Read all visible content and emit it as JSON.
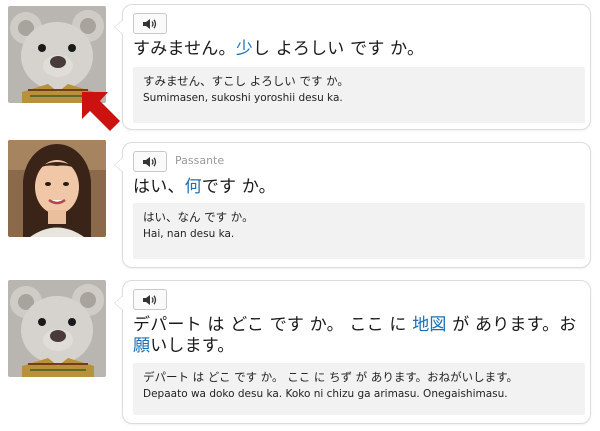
{
  "lines": [
    {
      "speaker": "",
      "main": [
        {
          "t": "すみません。",
          "hl": false
        },
        {
          "t": "少",
          "hl": true
        },
        {
          "t": "し よろしい です か。",
          "hl": false
        }
      ],
      "kana": "すみません、すこし よろしい です か。",
      "romaji": "Sumimasen, sukoshi yoroshii desu ka."
    },
    {
      "speaker": "Passante",
      "main": [
        {
          "t": "はい、",
          "hl": false
        },
        {
          "t": "何",
          "hl": true
        },
        {
          "t": "です か。",
          "hl": false
        }
      ],
      "kana": "はい、なん です か。",
      "romaji": "Hai, nan desu ka."
    },
    {
      "speaker": "",
      "main": [
        {
          "t": "デパート は どこ です か。 ここ に ",
          "hl": false
        },
        {
          "t": "地図",
          "hl": true
        },
        {
          "t": " が あります。お",
          "hl": false
        },
        {
          "t": "願",
          "hl": true
        },
        {
          "t": "いします。",
          "hl": false
        }
      ],
      "kana": "デパート は どこ です か。 ここ に ちず が あります。おねがいします。",
      "romaji": "Depaato wa doko desu ka. Koko ni chizu ga arimasu. Onegaishimasu."
    }
  ],
  "colors": {
    "highlight": "#1a6fb5",
    "arrow": "#cc1111",
    "bubble_border": "#dcdcdc",
    "subtitle_bg": "#f2f2f2"
  },
  "icons": {
    "audio": "speaker-icon",
    "pointer": "red-arrow-icon"
  }
}
